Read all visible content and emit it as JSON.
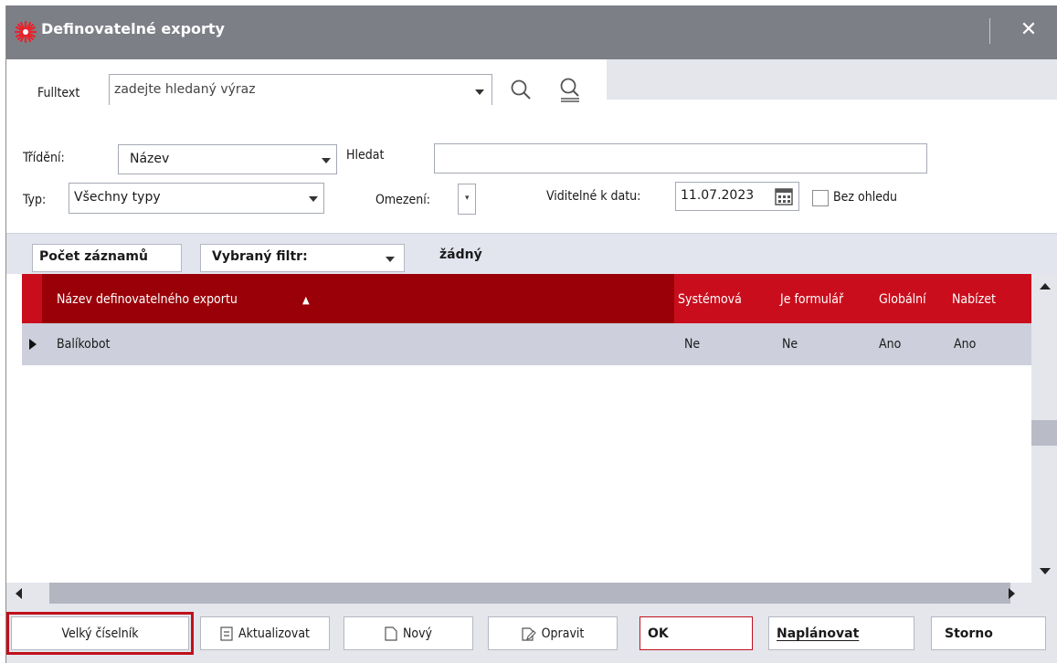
{
  "window": {
    "title": "Definovatelné exporty",
    "close_label": "✕"
  },
  "fulltext": {
    "label": "Fulltext",
    "placeholder": "zadejte hledaný výraz"
  },
  "filter": {
    "sort_label": "Třídění:",
    "sort_value": "Název",
    "search_label": "Hledat",
    "search_value": "",
    "type_label": "Typ:",
    "type_value": "Všechny typy",
    "limit_label": "Omezení:",
    "visible_date_label": "Viditelné k datu:",
    "visible_date_value": "11.07.2023",
    "ignore_label": "Bez ohledu",
    "ignore_checked": false
  },
  "records_bar": {
    "count_button": "Počet záznamů",
    "selected_filter_label": "Vybraný filtr:",
    "selected_filter_value": "žádný"
  },
  "grid": {
    "columns": [
      "Název definovatelného exportu",
      "Systémová",
      "Je formulář",
      "Globální",
      "Nabízet"
    ],
    "sort_indicator": "▲",
    "rows": [
      {
        "name": "Balíkobot",
        "system": "Ne",
        "form": "Ne",
        "global": "Ano",
        "offer": "Ano"
      }
    ]
  },
  "footer": {
    "big_list": "Velký číselník",
    "refresh": "Aktualizovat",
    "new": "Nový",
    "edit": "Opravit",
    "ok": "OK",
    "schedule": "Naplánovat",
    "cancel": "Storno"
  },
  "colors": {
    "titlebar": "#7d7f87",
    "header_primary": "#9a0008",
    "header_secondary": "#c90d1c",
    "selected_row": "#cdd0dc",
    "highlight_outline": "#c0101c"
  }
}
